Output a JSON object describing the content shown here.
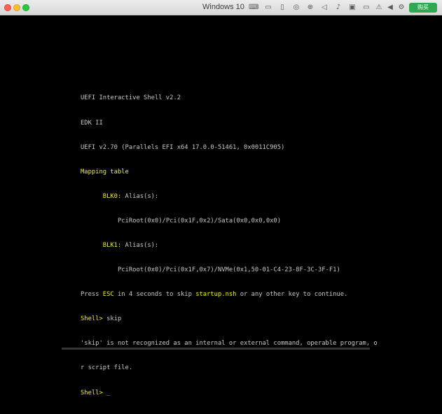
{
  "window": {
    "title": "Windows 10",
    "buy_label": "购买",
    "icons": [
      "keyboard-icon",
      "display-icon",
      "usb-icon",
      "cd-icon",
      "network-icon",
      "speaker-icon",
      "microphone-icon",
      "camera-icon",
      "video-icon",
      "alert-icon",
      "triangle-icon",
      "gear-icon"
    ]
  },
  "shell": {
    "line1": "UEFI Interactive Shell v2.2",
    "line2": "EDK II",
    "line3": "UEFI v2.70 (Parallels EFI x64 17.0.0-51461, 0x0011C905)",
    "mapping_table": "Mapping table",
    "blk0_label": "BLK0:",
    "blk0_alias": " Alias(s):",
    "blk0_path": "PciRoot(0x0)/Pci(0x1F,0x2)/Sata(0x0,0x0,0x0)",
    "blk1_label": "BLK1:",
    "blk1_alias": " Alias(s):",
    "blk1_path": "PciRoot(0x0)/Pci(0x1F,0x7)/NVMe(0x1,50-01-C4-23-8F-3C-3F-F1)",
    "press_pre": "Press ",
    "press_esc": "ESC",
    "press_mid": " in 4 seconds to skip ",
    "press_file": "startup.nsh",
    "press_post": " or any other key to continue.",
    "prompt": "Shell>",
    "cmd1": " skip",
    "err_line1": "'skip' is not recognized as an internal or external command, operable program, o",
    "err_line2": "r script file.",
    "cursor": " _"
  }
}
